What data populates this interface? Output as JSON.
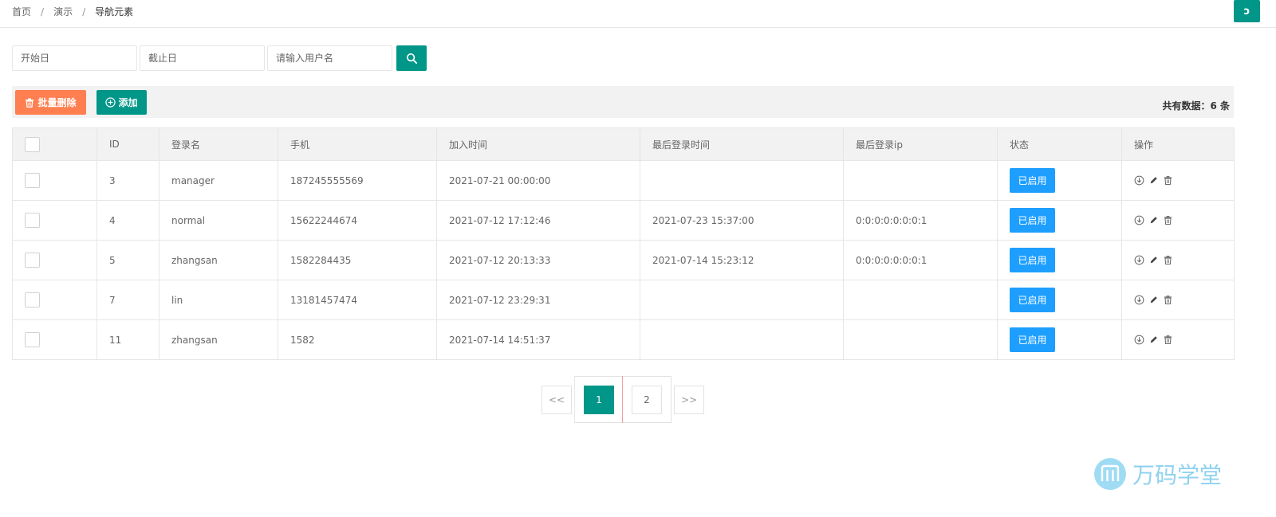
{
  "breadcrumb": {
    "items": [
      "首页",
      "演示"
    ],
    "current": "导航元素",
    "separator": "/"
  },
  "refresh_label": "ↄ",
  "search": {
    "start_placeholder": "开始日",
    "end_placeholder": "截止日",
    "username_placeholder": "请输入用户名"
  },
  "toolbar": {
    "batch_delete_label": "批量删除",
    "add_label": "添加",
    "total_text": "共有数据：6 条"
  },
  "table": {
    "columns": [
      "ID",
      "登录名",
      "手机",
      "加入时间",
      "最后登录时间",
      "最后登录ip",
      "状态",
      "操作"
    ],
    "rows": [
      {
        "id": "3",
        "login": "manager",
        "phone": "187245555569",
        "joined": "2021-07-21 00:00:00",
        "last_login": "",
        "last_ip": "",
        "status": "已启用"
      },
      {
        "id": "4",
        "login": "normal",
        "phone": "15622244674",
        "joined": "2021-07-12 17:12:46",
        "last_login": "2021-07-23 15:37:00",
        "last_ip": "0:0:0:0:0:0:0:1",
        "status": "已启用"
      },
      {
        "id": "5",
        "login": "zhangsan",
        "phone": "1582284435",
        "joined": "2021-07-12 20:13:33",
        "last_login": "2021-07-14 15:23:12",
        "last_ip": "0:0:0:0:0:0:0:1",
        "status": "已启用"
      },
      {
        "id": "7",
        "login": "lin",
        "phone": "13181457474",
        "joined": "2021-07-12 23:29:31",
        "last_login": "",
        "last_ip": "",
        "status": "已启用"
      },
      {
        "id": "11",
        "login": "zhangsan",
        "phone": "1582",
        "joined": "2021-07-14 14:51:37",
        "last_login": "",
        "last_ip": "",
        "status": "已启用"
      }
    ]
  },
  "pagination": {
    "prev": "<<",
    "current": "1",
    "page2": "2",
    "next": ">>"
  },
  "watermark": {
    "text": "万码学堂"
  },
  "colors": {
    "primary": "#009688",
    "warm": "#ff7f50",
    "status": "#1e9fff",
    "watermark": "#8fd2ef"
  },
  "icons": {
    "search": "search-icon",
    "trash": "trash-icon",
    "add": "plus-circle-icon",
    "download": "download-icon",
    "edit": "edit-icon",
    "delete": "delete-icon"
  }
}
